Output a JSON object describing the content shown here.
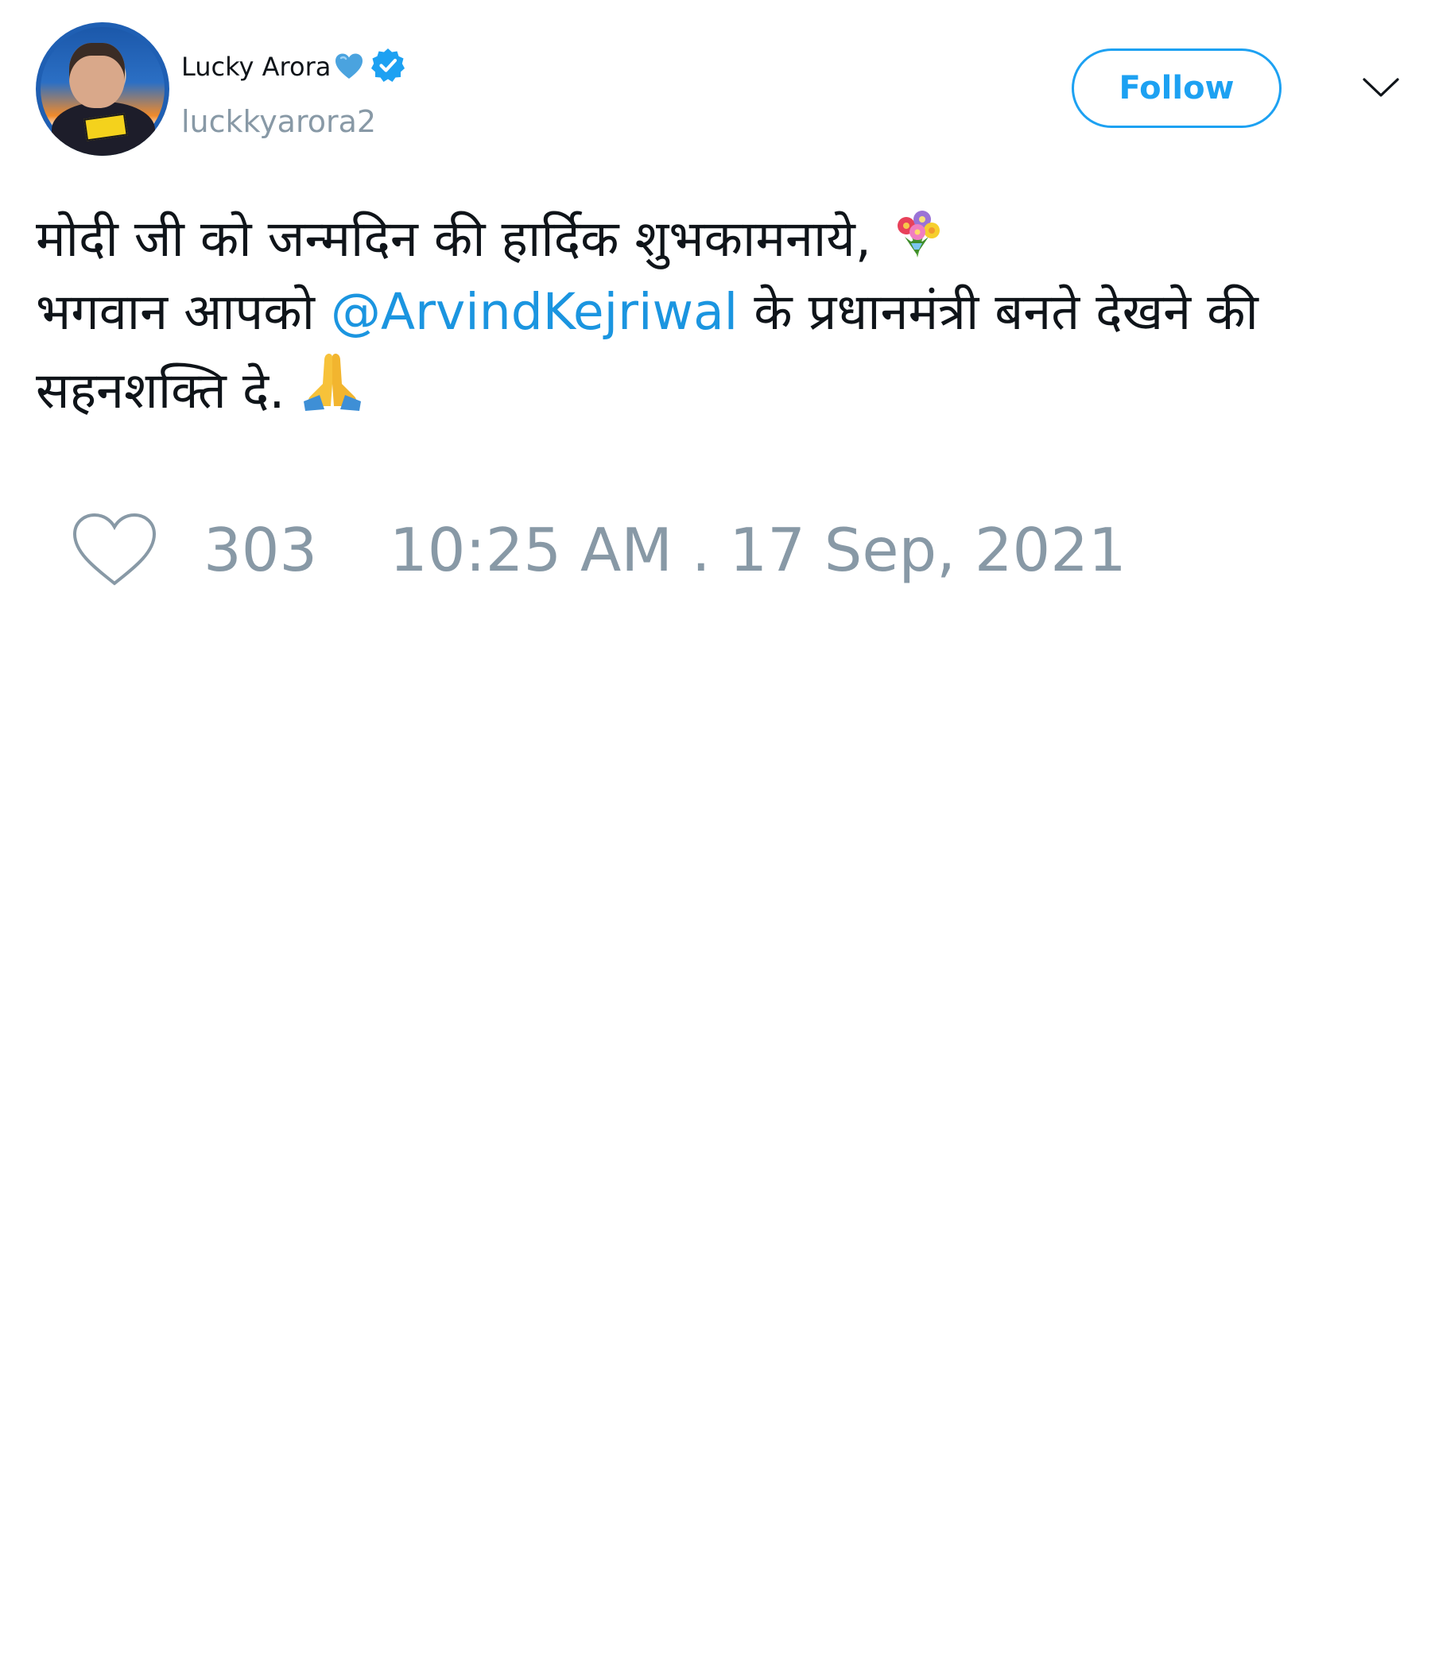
{
  "tweet": {
    "author": {
      "display_name": "Lucky Arora",
      "handle": "luckkyarora2",
      "name_emoji": "blue-heart-icon",
      "verified": true
    },
    "follow_label": "Follow",
    "text": {
      "line1": "मोदी जी को जन्मदिन की हार्दिक शुभकामनाये, ",
      "line2_before": "भगवान आपको ",
      "mention": "@ArvindKejriwal",
      "line2_after": " के प्रधानमंत्री बनते देखने की",
      "line3": "सहनशक्ति दे. "
    },
    "emojis": {
      "line1": "bouquet-icon",
      "line3": "folded-hands-icon"
    },
    "likes": "303",
    "timestamp": "10:25 AM . 17 Sep, 2021"
  },
  "colors": {
    "accent": "#1da1f2",
    "mention": "#1b95e0",
    "muted": "#8899a6",
    "text": "#0f1419"
  }
}
